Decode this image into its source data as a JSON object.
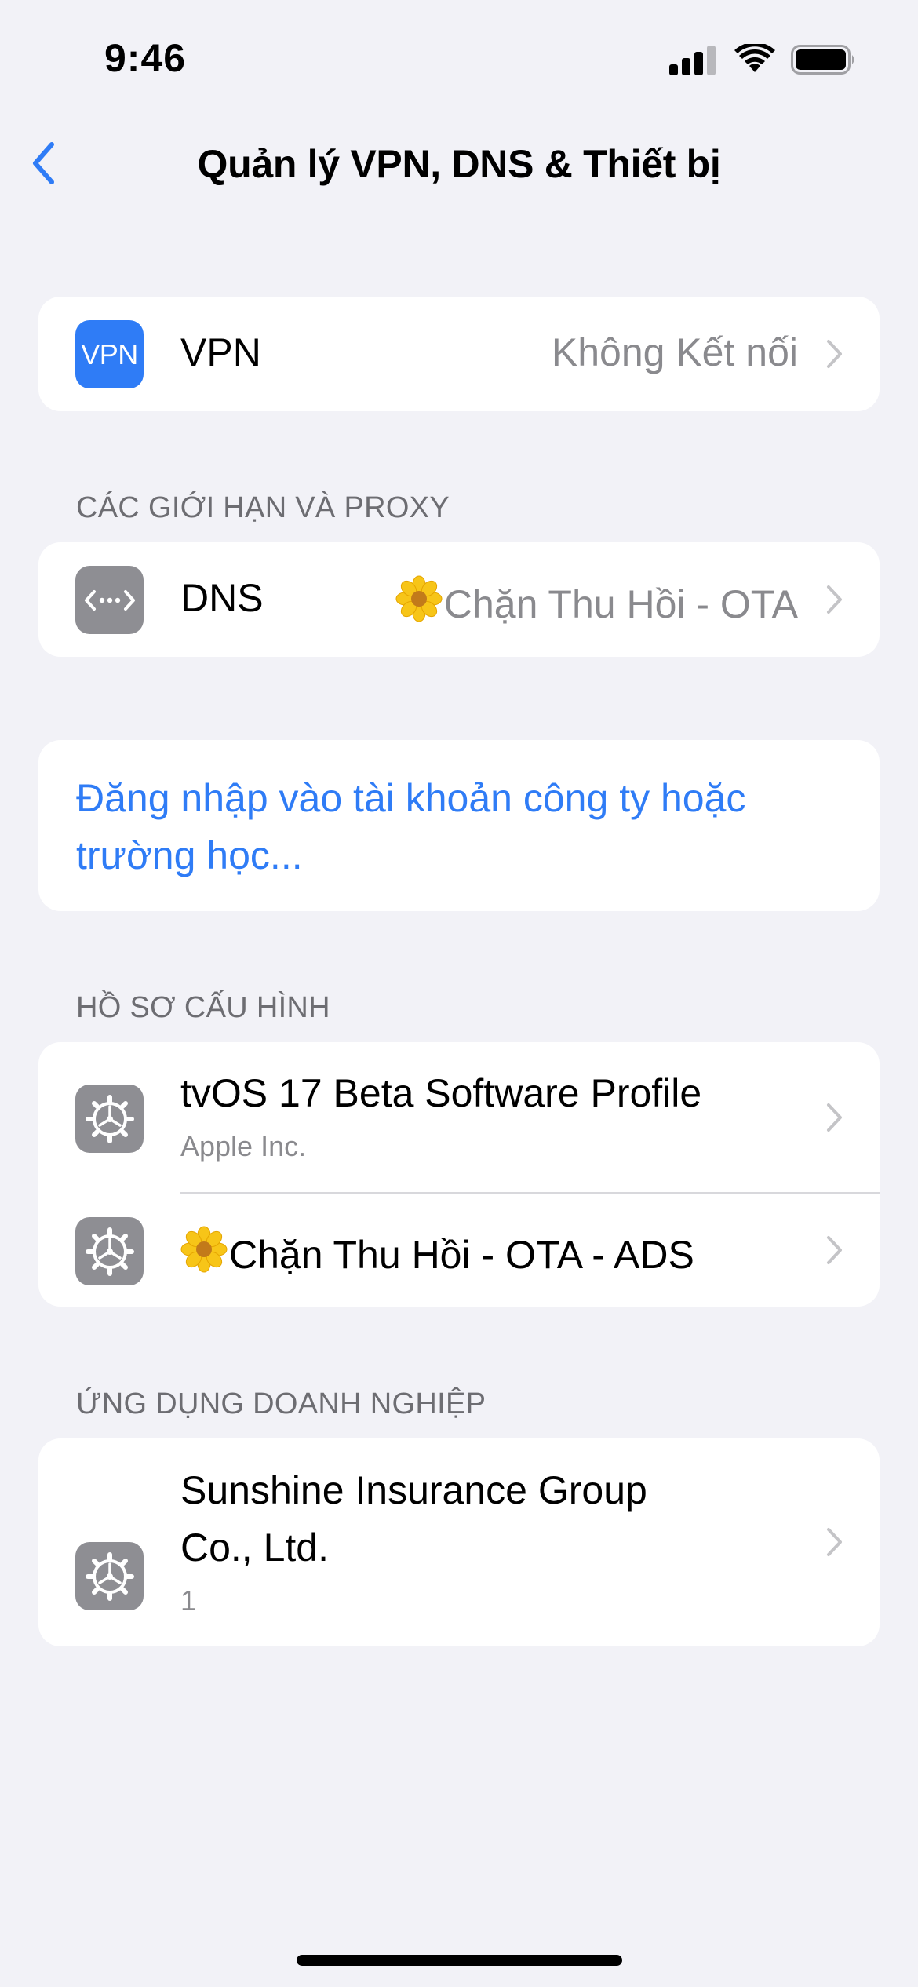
{
  "status_bar": {
    "time": "9:46"
  },
  "nav": {
    "title": "Quản lý VPN, DNS & Thiết bị",
    "back_icon": "chevron-left-icon"
  },
  "vpn": {
    "icon_text": "VPN",
    "label": "VPN",
    "value": "Không Kết nối"
  },
  "limits_section": {
    "header": "CÁC GIỚI HẠN VÀ PROXY"
  },
  "dns": {
    "label": "DNS",
    "value": "Chặn Thu Hồi - OTA",
    "icon": "dns-arrows-icon"
  },
  "sign_in": {
    "text": "Đăng nhập vào tài khoản công ty hoặc trường học..."
  },
  "profiles_section": {
    "header": "HỒ SƠ CẤU HÌNH",
    "items": [
      {
        "title": "tvOS 17 Beta Software Profile",
        "subtitle": "Apple Inc."
      },
      {
        "title": "Chặn Thu Hồi - OTA - ADS"
      }
    ]
  },
  "enterprise_section": {
    "header": "ỨNG DỤNG DOANH NGHIỆP",
    "items": [
      {
        "title": "Sunshine Insurance Group Co., Ltd.",
        "subtitle": "1"
      }
    ]
  },
  "colors": {
    "accent": "#2f7cf6",
    "background": "#f2f2f7",
    "icon_gray": "#8e8e93"
  }
}
